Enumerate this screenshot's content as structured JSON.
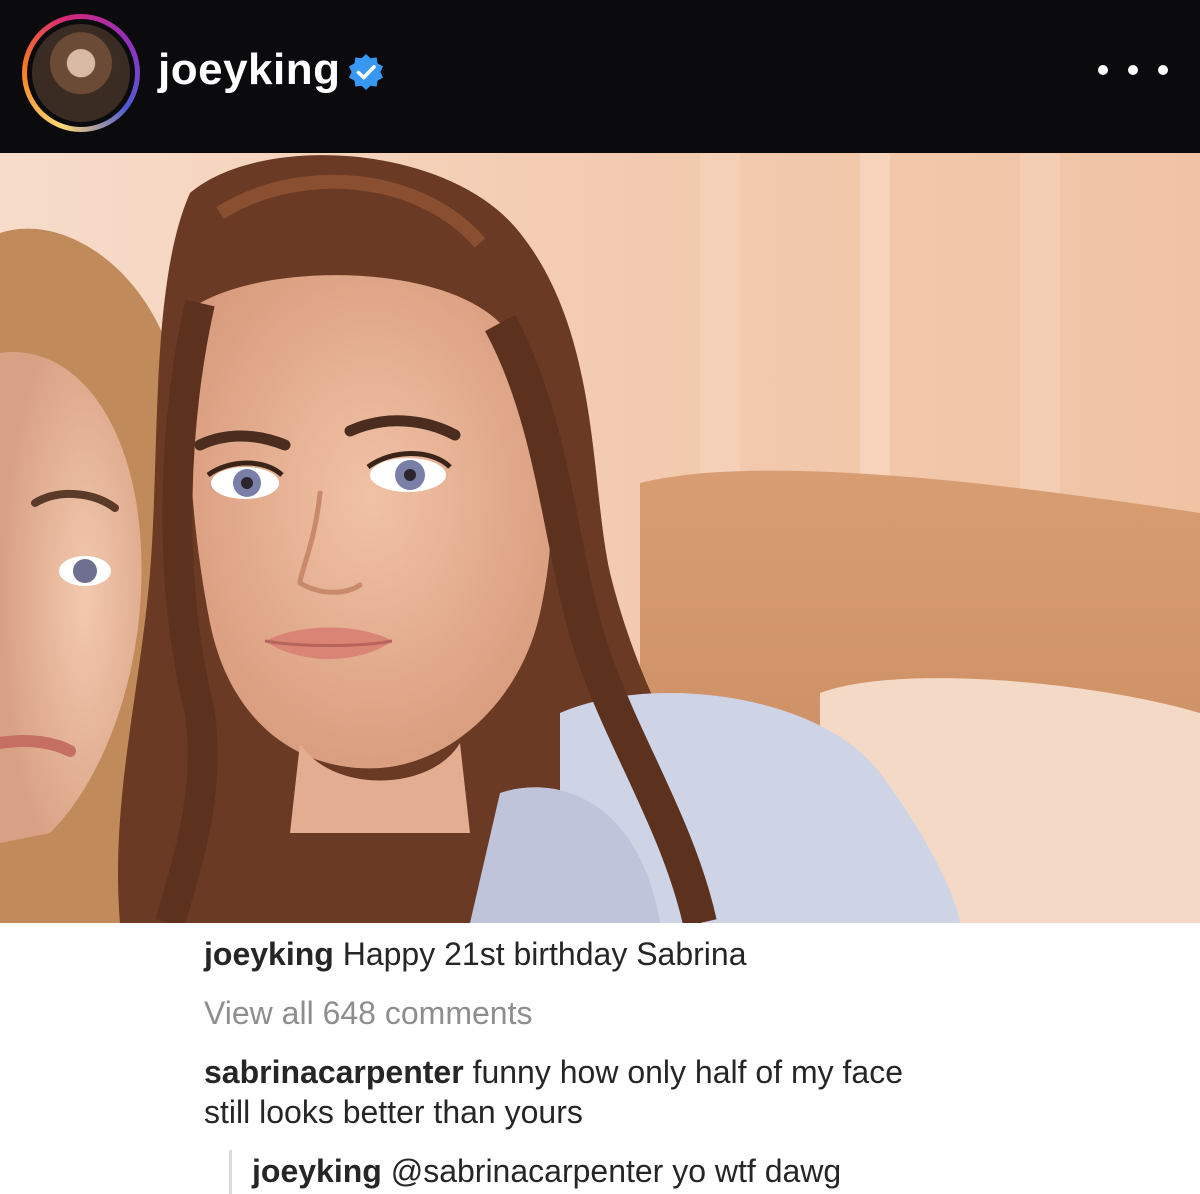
{
  "post": {
    "username": "joeyking",
    "verified_icon": "verified-badge-icon",
    "more_icon": "more-options-icon",
    "accent_color": "#3897f0"
  },
  "caption": {
    "username": "joeyking",
    "text": "Happy 21st birthday Sabrina"
  },
  "view_all_comments": "View all 648 comments",
  "comment": {
    "username": "sabrinacarpenter",
    "text_line1": "funny how only half of my face",
    "text_line2": "still looks better than yours"
  },
  "reply": {
    "username": "joeyking",
    "text": "@sabrinacarpenter yo wtf dawg"
  }
}
